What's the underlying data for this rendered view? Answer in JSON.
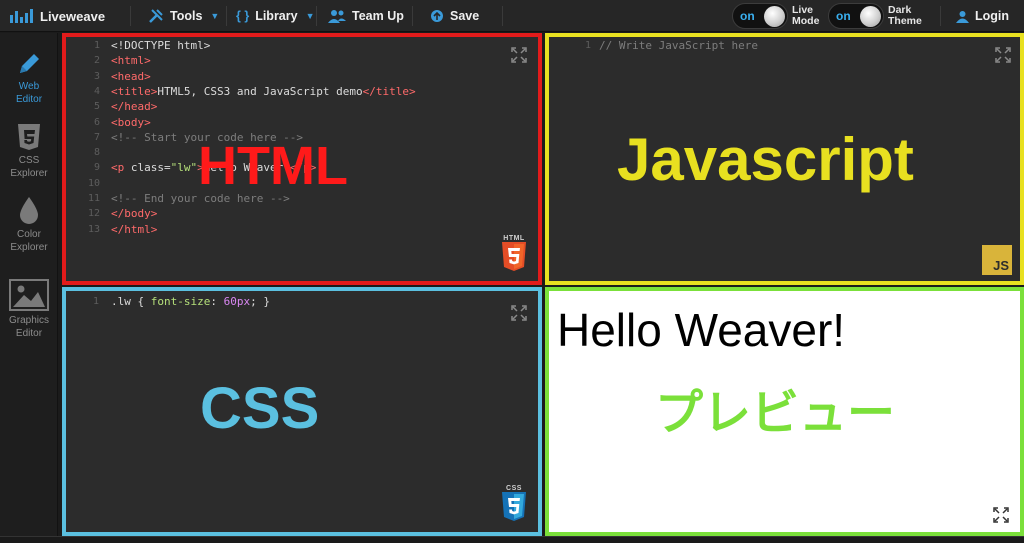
{
  "topbar": {
    "logo": "Liveweave",
    "tools": "Tools",
    "library": "Library",
    "library_icon": "{ }",
    "team_up": "Team Up",
    "save": "Save",
    "live_mode": {
      "state": "on",
      "line1": "Live",
      "line2": "Mode"
    },
    "dark_theme": {
      "state": "on",
      "line1": "Dark",
      "line2": "Theme"
    },
    "login": "Login"
  },
  "sidebar": {
    "items": [
      {
        "line1": "Web",
        "line2": "Editor",
        "icon": "pencil-icon"
      },
      {
        "line1": "CSS",
        "line2": "Explorer",
        "icon": "css3-icon"
      },
      {
        "line1": "Color",
        "line2": "Explorer",
        "icon": "drop-icon"
      },
      {
        "line1": "Graphics",
        "line2": "Editor",
        "icon": "image-icon"
      }
    ]
  },
  "html_panel": {
    "label": "HTML",
    "badge": "HTML",
    "line_numbers": [
      "1",
      "2",
      "3",
      "4",
      "5",
      "6",
      "7",
      "8",
      "9",
      "10",
      "11",
      "12",
      "13"
    ],
    "lines": [
      {
        "parts": [
          [
            "tag-plain",
            "<!DOCTYPE html>"
          ]
        ]
      },
      {
        "parts": [
          [
            "tag",
            "<html>"
          ]
        ]
      },
      {
        "parts": [
          [
            "tag",
            "<head>"
          ]
        ]
      },
      {
        "parts": [
          [
            "tag",
            "<title>"
          ],
          [
            "text",
            "HTML5, CSS3 and JavaScript demo"
          ],
          [
            "tag",
            "</title>"
          ]
        ]
      },
      {
        "parts": [
          [
            "tag",
            "</head>"
          ]
        ]
      },
      {
        "parts": [
          [
            "tag",
            "<body>"
          ]
        ]
      },
      {
        "parts": [
          [
            "cmt",
            "<!-- Start your code here -->"
          ]
        ]
      },
      {
        "parts": []
      },
      {
        "parts": [
          [
            "tag",
            "<p "
          ],
          [
            "text",
            "class="
          ],
          [
            "str",
            "\"lw\""
          ],
          [
            "tag",
            ">"
          ],
          [
            "text",
            "Hello Weaver!"
          ],
          [
            "tag",
            "</p>"
          ]
        ]
      },
      {
        "parts": []
      },
      {
        "parts": [
          [
            "cmt",
            "<!-- End your code here -->"
          ]
        ]
      },
      {
        "parts": [
          [
            "tag",
            "</body>"
          ]
        ]
      },
      {
        "parts": [
          [
            "tag",
            "</html>"
          ]
        ]
      }
    ]
  },
  "js_panel": {
    "label": "Javascript",
    "badge": "JS",
    "line_numbers": [
      "1"
    ],
    "comment": "// Write JavaScript here"
  },
  "css_panel": {
    "label": "CSS",
    "badge": "CSS",
    "line_numbers": [
      "1"
    ],
    "selector": ".lw { ",
    "property": "font-size",
    "colon": ": ",
    "value": "60px",
    "end": "; }"
  },
  "preview_panel": {
    "output": "Hello Weaver!",
    "label": "プレビュー"
  },
  "colors": {
    "html_frame": "#e21b1b",
    "js_frame": "#e8e020",
    "css_frame": "#5bc0e0",
    "preview_frame": "#7be03a",
    "accent": "#3a9ad9"
  }
}
